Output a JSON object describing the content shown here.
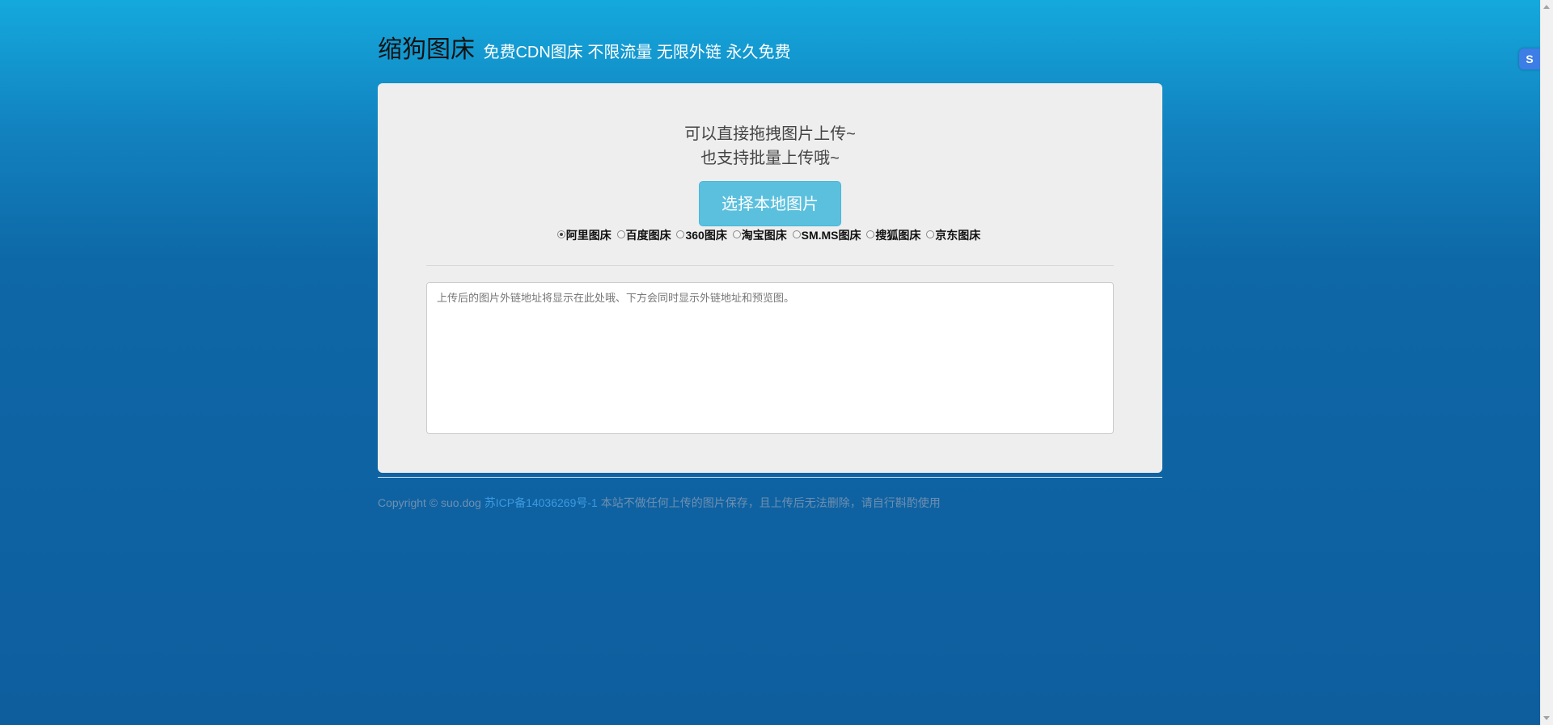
{
  "header": {
    "title": "缩狗图床",
    "subtitle": "免费CDN图床 不限流量 无限外链 永久免费"
  },
  "upload": {
    "hint_line1": "可以直接拖拽图片上传~",
    "hint_line2": "也支持批量上传哦~",
    "button_label": "选择本地图片"
  },
  "hosts": [
    {
      "label": "阿里图床",
      "checked": true
    },
    {
      "label": "百度图床",
      "checked": false
    },
    {
      "label": "360图床",
      "checked": false
    },
    {
      "label": "淘宝图床",
      "checked": false
    },
    {
      "label": "SM.MS图床",
      "checked": false
    },
    {
      "label": "搜狐图床",
      "checked": false
    },
    {
      "label": "京东图床",
      "checked": false
    }
  ],
  "result": {
    "placeholder": "上传后的图片外链地址将显示在此处哦、下方会同时显示外链地址和预览图。"
  },
  "footer": {
    "copyright": "Copyright © suo.dog ",
    "icp_link": "苏ICP备14036269号-1",
    "disclaimer": " 本站不做任何上传的图片保存，且上传后无法删除，请自行斟酌使用"
  },
  "side_widget": {
    "icon": "translate-icon",
    "glyph": "S"
  },
  "colors": {
    "bg_top": "#14a9dd",
    "bg_bottom": "#0e5e9e",
    "button": "#5bc0de",
    "panel": "#eeeeee"
  }
}
